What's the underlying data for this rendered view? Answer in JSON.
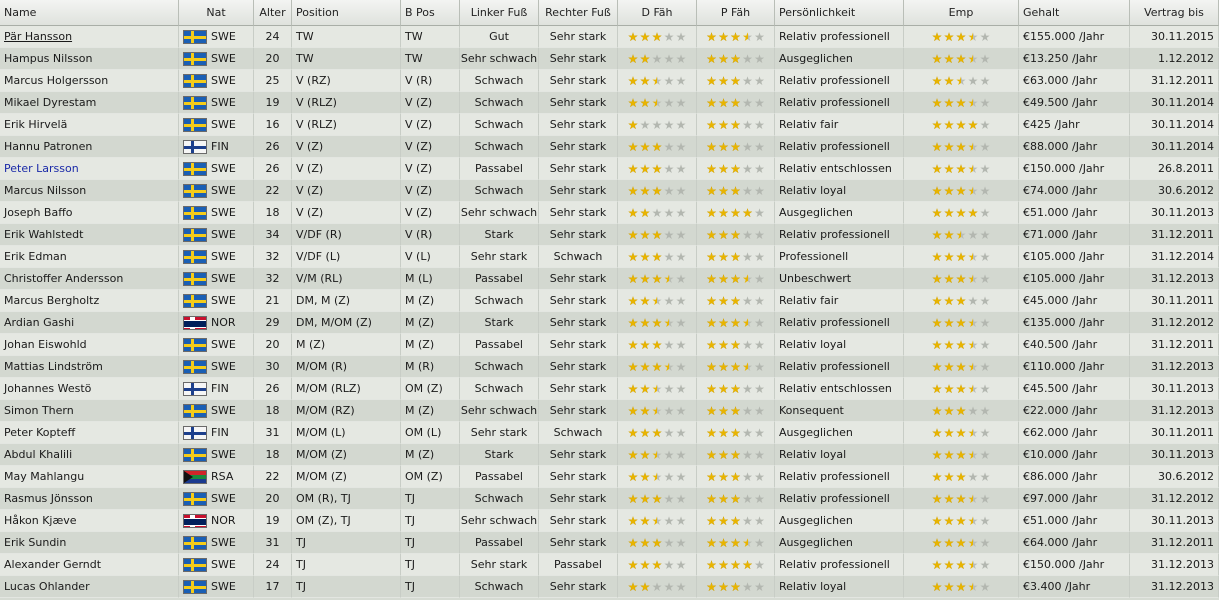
{
  "headers": {
    "name": "Name",
    "nat": "Nat",
    "alter": "Alter",
    "position": "Position",
    "bpos": "B Pos",
    "linker": "Linker Fuß",
    "rechter": "Rechter Fuß",
    "dfah": "D Fäh",
    "pfah": "P Fäh",
    "pers": "Persönlichkeit",
    "emp": "Emp",
    "gehalt": "Gehalt",
    "vertrag": "Vertrag bis"
  },
  "colors": {
    "star_full": "#e8b400",
    "star_empty": "#b3b7b0",
    "highlight_name": "#1b2aa8"
  },
  "rows": [
    {
      "name": "Pär Hansson",
      "nat": "SWE",
      "alter": "24",
      "position": "TW",
      "bpos": "TW",
      "linker": "Gut",
      "rechter": "Sehr stark",
      "dfah": 3,
      "pfah": 3.5,
      "pers": "Relativ professionell",
      "emp": 3.5,
      "gehalt": "€155.000 /Jahr",
      "vertrag": "30.11.2015",
      "state": "selected"
    },
    {
      "name": "Hampus Nilsson",
      "nat": "SWE",
      "alter": "20",
      "position": "TW",
      "bpos": "TW",
      "linker": "Sehr schwach",
      "rechter": "Sehr stark",
      "dfah": 2,
      "pfah": 3,
      "pers": "Ausgeglichen",
      "emp": 3.5,
      "gehalt": "€13.250 /Jahr",
      "vertrag": "1.12.2012"
    },
    {
      "name": "Marcus Holgersson",
      "nat": "SWE",
      "alter": "25",
      "position": "V (RZ)",
      "bpos": "V (R)",
      "linker": "Schwach",
      "rechter": "Sehr stark",
      "dfah": 2.5,
      "pfah": 3,
      "pers": "Relativ professionell",
      "emp": 2.5,
      "gehalt": "€63.000 /Jahr",
      "vertrag": "31.12.2011"
    },
    {
      "name": "Mikael Dyrestam",
      "nat": "SWE",
      "alter": "19",
      "position": "V (RLZ)",
      "bpos": "V (Z)",
      "linker": "Schwach",
      "rechter": "Sehr stark",
      "dfah": 2.5,
      "pfah": 3,
      "pers": "Relativ professionell",
      "emp": 3.5,
      "gehalt": "€49.500 /Jahr",
      "vertrag": "30.11.2014"
    },
    {
      "name": "Erik Hirvelä",
      "nat": "SWE",
      "alter": "16",
      "position": "V (RLZ)",
      "bpos": "V (Z)",
      "linker": "Schwach",
      "rechter": "Sehr stark",
      "dfah": 1,
      "pfah": 3,
      "pers": "Relativ fair",
      "emp": 4,
      "gehalt": "€425 /Jahr",
      "vertrag": "30.11.2014"
    },
    {
      "name": "Hannu Patronen",
      "nat": "FIN",
      "alter": "26",
      "position": "V (Z)",
      "bpos": "V (Z)",
      "linker": "Schwach",
      "rechter": "Sehr stark",
      "dfah": 3,
      "pfah": 3,
      "pers": "Relativ professionell",
      "emp": 3.5,
      "gehalt": "€88.000 /Jahr",
      "vertrag": "30.11.2014"
    },
    {
      "name": "Peter Larsson",
      "nat": "SWE",
      "alter": "26",
      "position": "V (Z)",
      "bpos": "V (Z)",
      "linker": "Passabel",
      "rechter": "Sehr stark",
      "dfah": 3,
      "pfah": 3,
      "pers": "Relativ entschlossen",
      "emp": 3.5,
      "gehalt": "€150.000 /Jahr",
      "vertrag": "26.8.2011",
      "state": "highlight"
    },
    {
      "name": "Marcus Nilsson",
      "nat": "SWE",
      "alter": "22",
      "position": "V (Z)",
      "bpos": "V (Z)",
      "linker": "Schwach",
      "rechter": "Sehr stark",
      "dfah": 3,
      "pfah": 3,
      "pers": "Relativ loyal",
      "emp": 3.5,
      "gehalt": "€74.000 /Jahr",
      "vertrag": "30.6.2012"
    },
    {
      "name": "Joseph Baffo",
      "nat": "SWE",
      "alter": "18",
      "position": "V (Z)",
      "bpos": "V (Z)",
      "linker": "Sehr schwach",
      "rechter": "Sehr stark",
      "dfah": 2,
      "pfah": 4,
      "pers": "Ausgeglichen",
      "emp": 4,
      "gehalt": "€51.000 /Jahr",
      "vertrag": "30.11.2013"
    },
    {
      "name": "Erik Wahlstedt",
      "nat": "SWE",
      "alter": "34",
      "position": "V/DF (R)",
      "bpos": "V (R)",
      "linker": "Stark",
      "rechter": "Sehr stark",
      "dfah": 3,
      "pfah": 3,
      "pers": "Relativ professionell",
      "emp": 2.5,
      "gehalt": "€71.000 /Jahr",
      "vertrag": "31.12.2011"
    },
    {
      "name": "Erik Edman",
      "nat": "SWE",
      "alter": "32",
      "position": "V/DF (L)",
      "bpos": "V (L)",
      "linker": "Sehr stark",
      "rechter": "Schwach",
      "dfah": 3,
      "pfah": 3,
      "pers": "Professionell",
      "emp": 3.5,
      "gehalt": "€105.000 /Jahr",
      "vertrag": "31.12.2014"
    },
    {
      "name": "Christoffer Andersson",
      "nat": "SWE",
      "alter": "32",
      "position": "V/M (RL)",
      "bpos": "M (L)",
      "linker": "Passabel",
      "rechter": "Sehr stark",
      "dfah": 3.5,
      "pfah": 3.5,
      "pers": "Unbeschwert",
      "emp": 3.5,
      "gehalt": "€105.000 /Jahr",
      "vertrag": "31.12.2013"
    },
    {
      "name": "Marcus Bergholtz",
      "nat": "SWE",
      "alter": "21",
      "position": "DM, M (Z)",
      "bpos": "M (Z)",
      "linker": "Schwach",
      "rechter": "Sehr stark",
      "dfah": 2.5,
      "pfah": 3,
      "pers": "Relativ fair",
      "emp": 3,
      "gehalt": "€45.000 /Jahr",
      "vertrag": "30.11.2011"
    },
    {
      "name": "Ardian Gashi",
      "nat": "NOR",
      "alter": "29",
      "position": "DM, M/OM (Z)",
      "bpos": "M (Z)",
      "linker": "Stark",
      "rechter": "Sehr stark",
      "dfah": 3.5,
      "pfah": 3.5,
      "pers": "Relativ professionell",
      "emp": 3.5,
      "gehalt": "€135.000 /Jahr",
      "vertrag": "31.12.2012"
    },
    {
      "name": "Johan Eiswohld",
      "nat": "SWE",
      "alter": "20",
      "position": "M (Z)",
      "bpos": "M (Z)",
      "linker": "Passabel",
      "rechter": "Sehr stark",
      "dfah": 3,
      "pfah": 3,
      "pers": "Relativ loyal",
      "emp": 3.5,
      "gehalt": "€40.500 /Jahr",
      "vertrag": "31.12.2011"
    },
    {
      "name": "Mattias Lindström",
      "nat": "SWE",
      "alter": "30",
      "position": "M/OM (R)",
      "bpos": "M (R)",
      "linker": "Schwach",
      "rechter": "Sehr stark",
      "dfah": 3.5,
      "pfah": 3.5,
      "pers": "Relativ professionell",
      "emp": 3.5,
      "gehalt": "€110.000 /Jahr",
      "vertrag": "31.12.2013"
    },
    {
      "name": "Johannes Westö",
      "nat": "FIN",
      "alter": "26",
      "position": "M/OM (RLZ)",
      "bpos": "OM (Z)",
      "linker": "Schwach",
      "rechter": "Sehr stark",
      "dfah": 2.5,
      "pfah": 3,
      "pers": "Relativ entschlossen",
      "emp": 3.5,
      "gehalt": "€45.500 /Jahr",
      "vertrag": "30.11.2013"
    },
    {
      "name": "Simon Thern",
      "nat": "SWE",
      "alter": "18",
      "position": "M/OM (RZ)",
      "bpos": "M (Z)",
      "linker": "Sehr schwach",
      "rechter": "Sehr stark",
      "dfah": 2.5,
      "pfah": 3,
      "pers": "Konsequent",
      "emp": 3,
      "gehalt": "€22.000 /Jahr",
      "vertrag": "31.12.2013"
    },
    {
      "name": "Peter Kopteff",
      "nat": "FIN",
      "alter": "31",
      "position": "M/OM (L)",
      "bpos": "OM (L)",
      "linker": "Sehr stark",
      "rechter": "Schwach",
      "dfah": 3,
      "pfah": 3,
      "pers": "Ausgeglichen",
      "emp": 3.5,
      "gehalt": "€62.000 /Jahr",
      "vertrag": "30.11.2011"
    },
    {
      "name": "Abdul Khalili",
      "nat": "SWE",
      "alter": "18",
      "position": "M/OM (Z)",
      "bpos": "M (Z)",
      "linker": "Stark",
      "rechter": "Sehr stark",
      "dfah": 2.5,
      "pfah": 3,
      "pers": "Relativ loyal",
      "emp": 3.5,
      "gehalt": "€10.000 /Jahr",
      "vertrag": "30.11.2013"
    },
    {
      "name": "May Mahlangu",
      "nat": "RSA",
      "alter": "22",
      "position": "M/OM (Z)",
      "bpos": "OM (Z)",
      "linker": "Passabel",
      "rechter": "Sehr stark",
      "dfah": 2.5,
      "pfah": 3,
      "pers": "Relativ professionell",
      "emp": 3,
      "gehalt": "€86.000 /Jahr",
      "vertrag": "30.6.2012"
    },
    {
      "name": "Rasmus Jönsson",
      "nat": "SWE",
      "alter": "20",
      "position": "OM (R), TJ",
      "bpos": "TJ",
      "linker": "Schwach",
      "rechter": "Sehr stark",
      "dfah": 3,
      "pfah": 3,
      "pers": "Relativ professionell",
      "emp": 3.5,
      "gehalt": "€97.000 /Jahr",
      "vertrag": "31.12.2012"
    },
    {
      "name": "Håkon Kjæve",
      "nat": "NOR",
      "alter": "19",
      "position": "OM (Z), TJ",
      "bpos": "TJ",
      "linker": "Sehr schwach",
      "rechter": "Sehr stark",
      "dfah": 2.5,
      "pfah": 3,
      "pers": "Ausgeglichen",
      "emp": 3.5,
      "gehalt": "€51.000 /Jahr",
      "vertrag": "30.11.2013"
    },
    {
      "name": "Erik Sundin",
      "nat": "SWE",
      "alter": "31",
      "position": "TJ",
      "bpos": "TJ",
      "linker": "Passabel",
      "rechter": "Sehr stark",
      "dfah": 3,
      "pfah": 3.5,
      "pers": "Ausgeglichen",
      "emp": 3.5,
      "gehalt": "€64.000 /Jahr",
      "vertrag": "31.12.2011"
    },
    {
      "name": "Alexander Gerndt",
      "nat": "SWE",
      "alter": "24",
      "position": "TJ",
      "bpos": "TJ",
      "linker": "Sehr stark",
      "rechter": "Passabel",
      "dfah": 3,
      "pfah": 4,
      "pers": "Relativ professionell",
      "emp": 3.5,
      "gehalt": "€150.000 /Jahr",
      "vertrag": "31.12.2013"
    },
    {
      "name": "Lucas Ohlander",
      "nat": "SWE",
      "alter": "17",
      "position": "TJ",
      "bpos": "TJ",
      "linker": "Schwach",
      "rechter": "Sehr stark",
      "dfah": 2,
      "pfah": 3,
      "pers": "Relativ loyal",
      "emp": 3.5,
      "gehalt": "€3.400 /Jahr",
      "vertrag": "31.12.2013"
    }
  ]
}
